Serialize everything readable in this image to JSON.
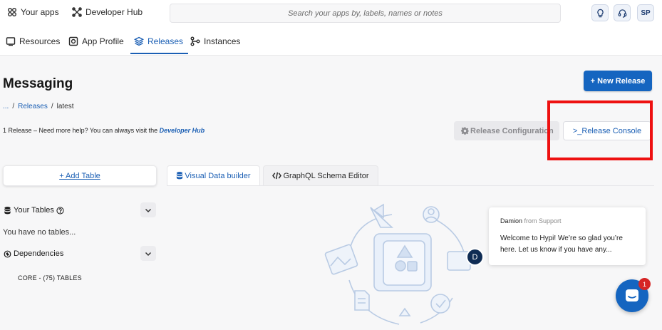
{
  "topbar": {
    "your_apps": "Your apps",
    "developer_hub": "Developer Hub",
    "search_placeholder": "Search your apps by, labels, names or notes",
    "user_initials": "SP"
  },
  "nav": {
    "tabs": [
      {
        "label": "Resources",
        "icon": "resources-icon"
      },
      {
        "label": "App Profile",
        "icon": "app-profile-icon"
      },
      {
        "label": "Releases",
        "icon": "stack-icon",
        "active": true
      },
      {
        "label": "Instances",
        "icon": "instances-icon"
      }
    ]
  },
  "page": {
    "title": "Messaging",
    "new_release_label": "+ New Release",
    "breadcrumb": [
      "...",
      "/",
      "Releases",
      "/",
      "latest"
    ],
    "help_text": "1 Release – Need more help? You can always visit the ",
    "help_link": "Developer Hub",
    "release_config_label": "Release Configuration",
    "release_console_label": ">_Release Console"
  },
  "tables": {
    "add_table_label": "+ Add Table",
    "editor_tabs": [
      {
        "label": "Visual Data builder",
        "active": true
      },
      {
        "label": "GraphQL Schema Editor",
        "active": false
      }
    ],
    "your_tables_label": "Your Tables",
    "no_tables_text": "You have no tables...",
    "dependencies_label": "Dependencies",
    "core_label": "CORE - (75) TABLES"
  },
  "chat": {
    "sender_name": "Damion",
    "sender_suffix": " from Support",
    "message": "Welcome to Hypi! We’re so glad you’re here. Let us know if you have any...",
    "avatar_initial": "D",
    "badge_count": "1"
  },
  "colors": {
    "accent": "#1565c0",
    "highlight": "#ee1111",
    "avatar": "#0f2c54"
  }
}
